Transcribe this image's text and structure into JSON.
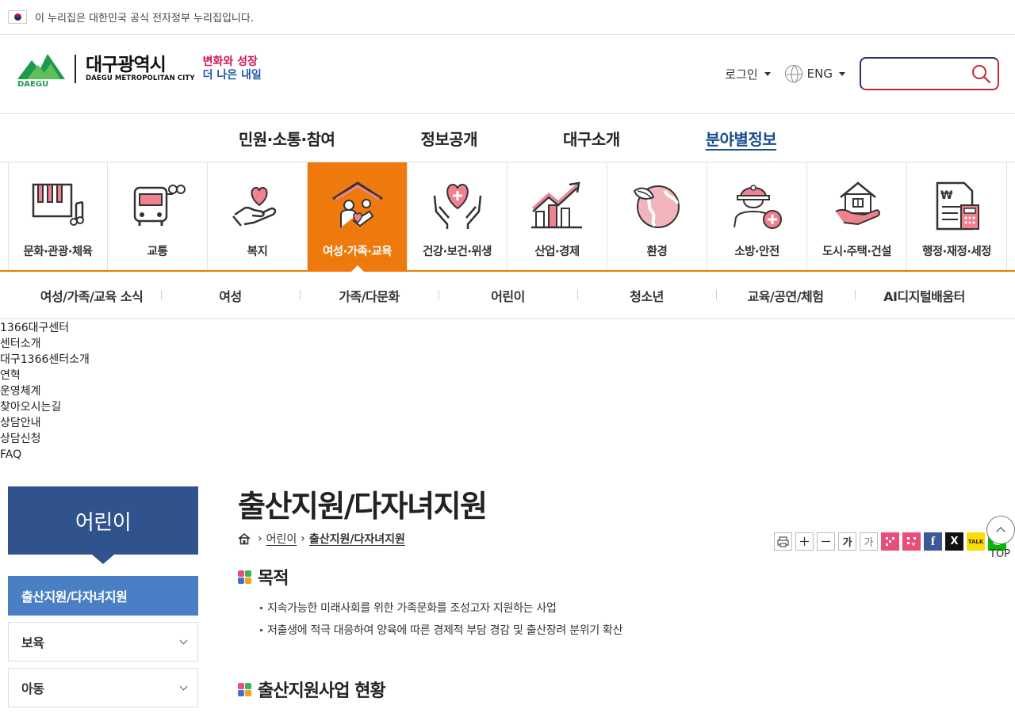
{
  "gov_bar": {
    "text": "이 누리집은 대한민국 공식 전자정부 누리집입니다."
  },
  "logo": {
    "mark_text": "DAEGU",
    "name_kr": "대구광역시",
    "name_en": "DAEGU METROPOLITAN CITY",
    "slogan_line1": "변화와 성장",
    "slogan_line2": "더 나은 내일"
  },
  "util": {
    "login": "로그인",
    "lang": "ENG",
    "search_placeholder": ""
  },
  "gnb": {
    "items": [
      {
        "label": "민원·소통·참여"
      },
      {
        "label": "정보공개"
      },
      {
        "label": "대구소개"
      },
      {
        "label": "분야별정보"
      }
    ],
    "active": 3
  },
  "categories": [
    {
      "label": "문화·관광·체육",
      "icon": "piano-icon"
    },
    {
      "label": "교통",
      "icon": "bus-icon"
    },
    {
      "label": "복지",
      "icon": "heart-hand-icon"
    },
    {
      "label": "여성·가족·교육",
      "icon": "family-house-icon"
    },
    {
      "label": "건강·보건·위생",
      "icon": "heart-care-icon"
    },
    {
      "label": "산업·경제",
      "icon": "growth-chart-icon"
    },
    {
      "label": "환경",
      "icon": "earth-leaf-icon"
    },
    {
      "label": "소방·안전",
      "icon": "firefighter-icon"
    },
    {
      "label": "도시·주택·건설",
      "icon": "house-hand-icon"
    },
    {
      "label": "행정·재정·세정",
      "icon": "document-calculator-icon"
    }
  ],
  "active_category": 3,
  "subnav": [
    {
      "label": "여성/가족/교육 소식"
    },
    {
      "label": "여성"
    },
    {
      "label": "가족/다문화"
    },
    {
      "label": "어린이"
    },
    {
      "label": "청소년"
    },
    {
      "label": "교육/공연/체험"
    },
    {
      "label": "AI디지털배움터"
    }
  ],
  "rawlist": [
    "1366대구센터",
    "센터소개",
    "대구1366센터소개",
    "연혁",
    "운영체계",
    "찾아오시는길",
    "상담안내",
    "상담신청",
    "FAQ"
  ],
  "sidebar": {
    "title": "어린이",
    "items": [
      {
        "label": "출산지원/다자녀지원"
      },
      {
        "label": "보육"
      },
      {
        "label": "아동"
      }
    ]
  },
  "content": {
    "title": "출산지원/다자녀지원",
    "breadcrumb": {
      "level1": "어린이",
      "current": "출산지원/다자녀지원"
    },
    "tools": {
      "font_large": "가",
      "font_small": "가",
      "facebook": "f",
      "x": "X",
      "kakao": "TALK"
    },
    "top_label": "TOP",
    "sections": [
      {
        "title": "목적",
        "bullets": [
          "지속가능한 미래사회를 위한 가족문화를 조성고자 지원하는 사업",
          "저출생에 적극 대응하여 양육에 따른 경제적 부담 경감 및 출산장려 분위기 확산"
        ]
      },
      {
        "title": "출산지원사업 현황",
        "bullets": []
      }
    ]
  },
  "colors": {
    "accent_orange": "#ee7a0e",
    "sidebar_blue": "#30538e",
    "sidebar_active": "#4a7fc6",
    "brand_green": "#1e9a4b",
    "icon_pink": "#f0828f"
  }
}
